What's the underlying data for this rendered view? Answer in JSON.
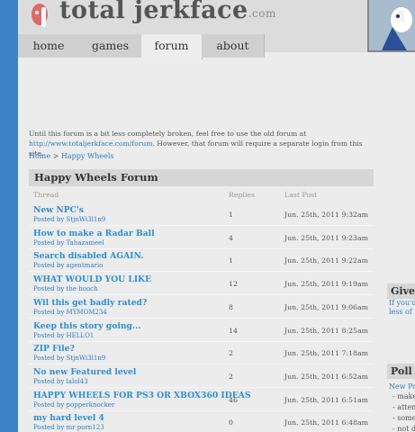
{
  "header": {
    "logo_text": "total jerkface",
    "logo_domain": ".com"
  },
  "nav": {
    "tabs": [
      {
        "label": "home"
      },
      {
        "label": "games"
      },
      {
        "label": "forum"
      },
      {
        "label": "about"
      }
    ],
    "active": "forum"
  },
  "notice": {
    "text_before": "Until this forum is a bit less completely broken, feel free to use the old forum at ",
    "link": "http://www.totaljerkface.com/forum",
    "text_after": ". However, that forum will require a separate login from this site."
  },
  "breadcrumb": {
    "home": "Home",
    "separator": " > ",
    "current": "Happy Wheels"
  },
  "forum": {
    "title": "Happy Wheels Forum",
    "columns": {
      "thread": "Thread",
      "replies": "Replies",
      "last_post": "Last Post"
    },
    "threads": [
      {
        "title": "New NPC's",
        "author": "Posted by StjnWi3l1n9",
        "replies": "1",
        "last_post": "Jun. 25th, 2011 9:32am"
      },
      {
        "title": "How to make a Radar Ball",
        "author": "Posted by Tahazameel",
        "replies": "4",
        "last_post": "Jun. 25th, 2011 9:23am"
      },
      {
        "title": "Search disabled AGAIN.",
        "author": "Posted by agentmario",
        "replies": "1",
        "last_post": "Jun. 25th, 2011 9:22am"
      },
      {
        "title": "WHAT WOULD YOU LIKE",
        "author": "Posted by the hooch",
        "replies": "12",
        "last_post": "Jun. 25th, 2011 9:19am"
      },
      {
        "title": "Wil this get badly rated?",
        "author": "Posted by MYMOM234",
        "replies": "8",
        "last_post": "Jun. 25th, 2011 9:06am"
      },
      {
        "title": "Keep this story going...",
        "author": "Posted by HELLO1",
        "replies": "14",
        "last_post": "Jun. 25th, 2011 8:25am"
      },
      {
        "title": "ZIP File?",
        "author": "Posted by StjnWi3l1n9",
        "replies": "2",
        "last_post": "Jun. 25th, 2011 7:18am"
      },
      {
        "title": "No new Featured level",
        "author": "Posted by lalol43",
        "replies": "2",
        "last_post": "Jun. 25th, 2011 6:52am"
      },
      {
        "title": "HAPPY WHEELS FOR PS3 OR XBOX360 IDEAS",
        "author": "Posted by popperknocker",
        "replies": "46",
        "last_post": "Jun. 25th, 2011 6:51am"
      },
      {
        "title": "my hard level 4",
        "author": "Posted by mr porn123",
        "replies": "0",
        "last_post": "Jun. 25th, 2011 6:48am"
      }
    ]
  },
  "sidebar": {
    "give_head": "Give F",
    "give_text_1": "If you'd l",
    "give_text_2": "less of m",
    "poll_head": "Poll",
    "poll_link": "New Po",
    "poll_items": [
      "- make",
      "- atten",
      "- some",
      "- not d"
    ]
  },
  "colors": {
    "accent_blue": "#3d82c5",
    "link_blue": "#2f8fd0"
  }
}
